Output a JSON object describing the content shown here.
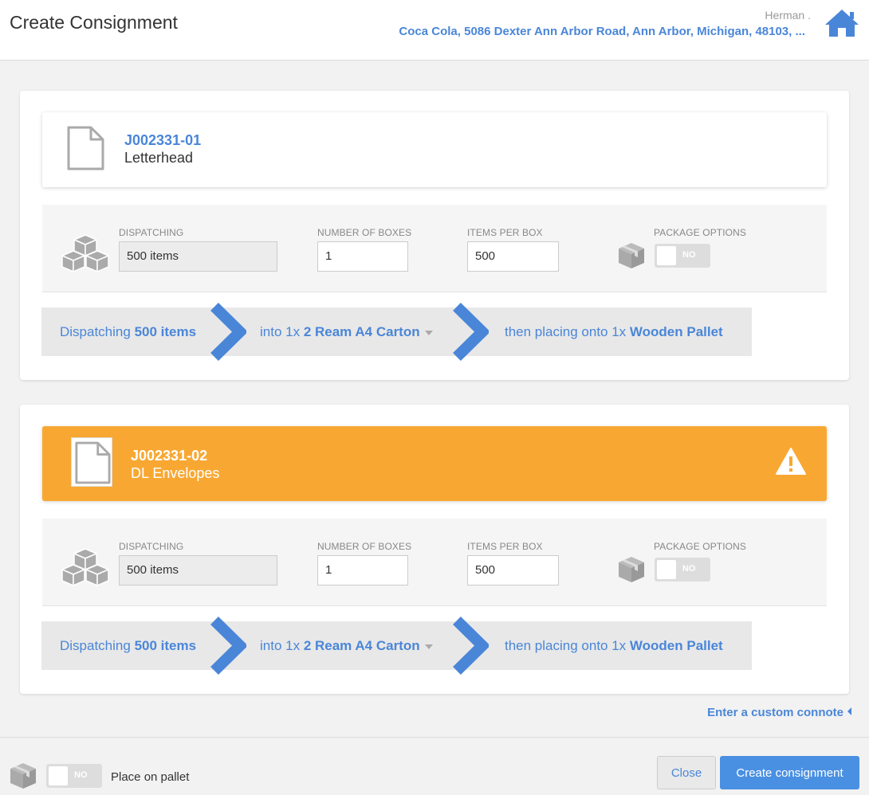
{
  "header": {
    "title": "Create Consignment",
    "user": "Herman .",
    "address": "Coca Cola, 5086 Dexter Ann Arbor Road, Ann Arbor, Michigan, 48103, ...",
    "home_icon": "home-icon"
  },
  "labels": {
    "dispatching": "DISPATCHING",
    "number_of_boxes": "NUMBER OF BOXES",
    "items_per_box": "ITEMS PER BOX",
    "package_options": "PACKAGE OPTIONS"
  },
  "jobs": [
    {
      "code": "J002331-01",
      "name": "Letterhead",
      "warning": false,
      "dispatching": "500 items",
      "number_of_boxes": "1",
      "items_per_box": "500",
      "package_toggle": "NO",
      "flow": {
        "dispatch_prefix": "Dispatching ",
        "dispatch_qty": "500 items",
        "into_prefix": "into 1x ",
        "box_type": "2 Ream A4 Carton",
        "then_prefix": "then placing onto 1x ",
        "pallet_type": "Wooden Pallet"
      }
    },
    {
      "code": "J002331-02",
      "name": "DL Envelopes",
      "warning": true,
      "dispatching": "500 items",
      "number_of_boxes": "1",
      "items_per_box": "500",
      "package_toggle": "NO",
      "flow": {
        "dispatch_prefix": "Dispatching ",
        "dispatch_qty": "500 items",
        "into_prefix": "into 1x ",
        "box_type": "2 Ream A4 Carton",
        "then_prefix": "then placing onto 1x ",
        "pallet_type": "Wooden Pallet"
      }
    }
  ],
  "custom_connote": "Enter a custom connote",
  "footer": {
    "pallet_toggle": "NO",
    "pallet_label": "Place on pallet",
    "close_label": "Close",
    "create_label": "Create consignment"
  },
  "colors": {
    "accent": "#4a86d8",
    "warning": "#f8a832",
    "primary_button": "#4a90e2"
  }
}
